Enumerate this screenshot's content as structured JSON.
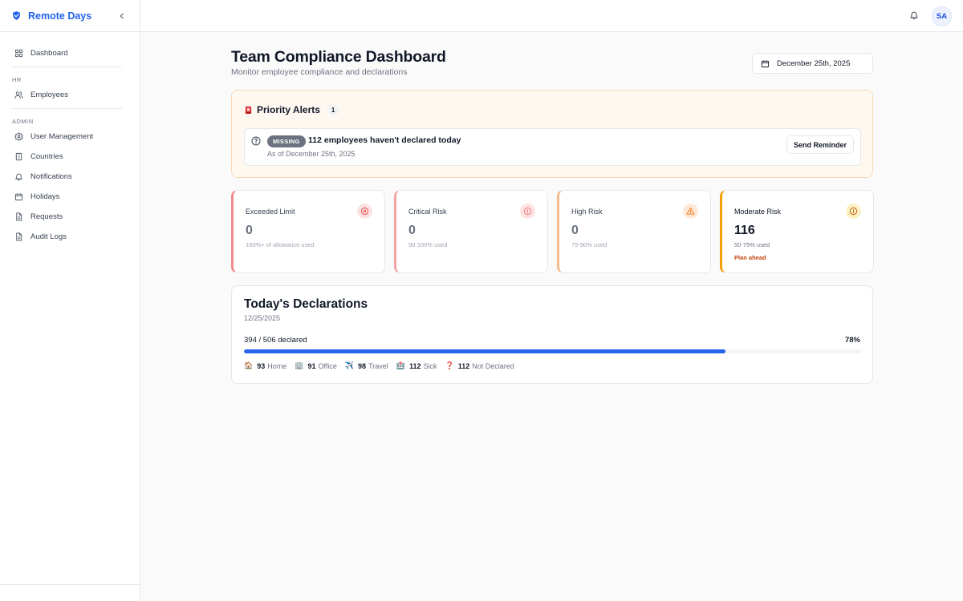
{
  "app": {
    "title": "Remote Days"
  },
  "sidebar": {
    "dashboard": "Dashboard",
    "group_hr": "HR",
    "employees": "Employees",
    "group_admin": "ADMIN",
    "admin_items": [
      {
        "label": "User Management",
        "icon": "settings-icon"
      },
      {
        "label": "Countries",
        "icon": "building-icon"
      },
      {
        "label": "Notifications",
        "icon": "bell-icon"
      },
      {
        "label": "Holidays",
        "icon": "calendar-icon"
      },
      {
        "label": "Requests",
        "icon": "file-icon"
      },
      {
        "label": "Audit Logs",
        "icon": "file-icon"
      }
    ]
  },
  "header": {
    "avatar_initials": "SA"
  },
  "page": {
    "title": "Team Compliance Dashboard",
    "subtitle": "Monitor employee compliance and declarations",
    "date": "December 25th, 2025"
  },
  "alerts": {
    "title": "Priority Alerts",
    "count": "1",
    "item": {
      "badge": "MISSING",
      "message": "112 employees haven't declared today",
      "sub": "As of December 25th, 2025",
      "action": "Send Reminder"
    }
  },
  "risk_cards": [
    {
      "label": "Exceeded Limit",
      "value": "0",
      "note": "100%+ of allowance used",
      "accent": "#f28b8b"
    },
    {
      "label": "Critical Risk",
      "value": "0",
      "note": "90-100% used",
      "accent": "#f5a3a3"
    },
    {
      "label": "High Risk",
      "value": "0",
      "note": "75-90% used",
      "accent": "#f7b98a"
    },
    {
      "label": "Moderate Risk",
      "value": "116",
      "note": "50-75% used",
      "extra": "Plan ahead",
      "accent": "#f59e0b"
    }
  ],
  "declarations": {
    "title": "Today's Declarations",
    "date": "12/25/2025",
    "progress_label": "394 / 506 declared",
    "percent": "78%",
    "progress_fraction": 0.78,
    "stats": [
      {
        "emoji": "🏠",
        "count": "93",
        "label": "Home"
      },
      {
        "emoji": "🏢",
        "count": "91",
        "label": "Office"
      },
      {
        "emoji": "✈️",
        "count": "98",
        "label": "Travel"
      },
      {
        "emoji": "🏥",
        "count": "112",
        "label": "Sick"
      },
      {
        "emoji": "❓",
        "count": "112",
        "label": "Not Declared"
      }
    ]
  },
  "colors": {
    "brand": "#2563eb",
    "alert_bg": "#fff8f1",
    "alert_border": "#fcd9b6"
  }
}
